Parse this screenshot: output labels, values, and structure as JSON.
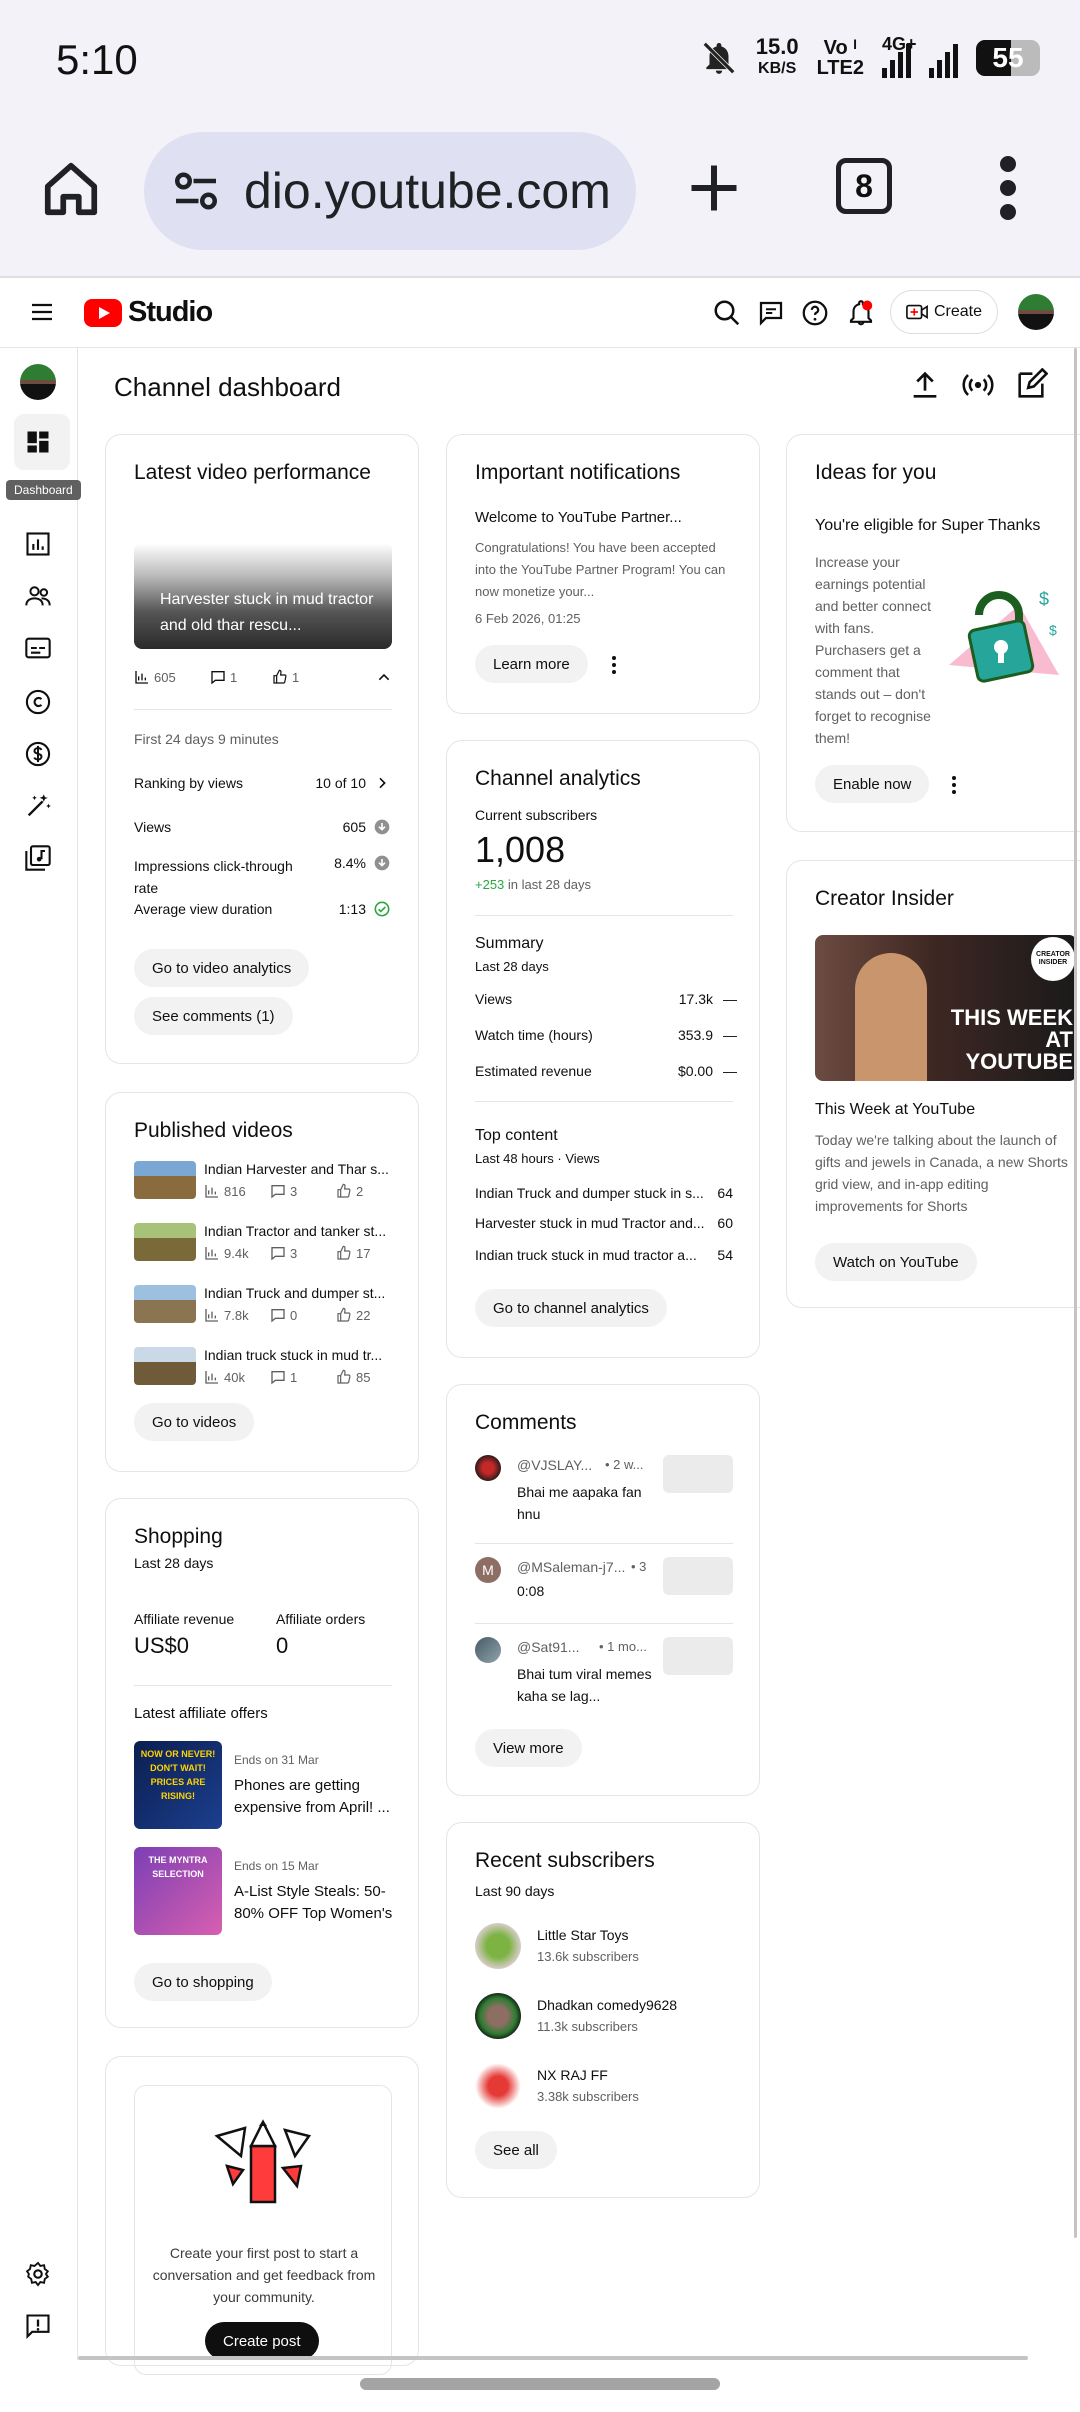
{
  "status_bar": {
    "time": "5:10",
    "speed_value": "15.0",
    "speed_unit": "KB/S",
    "volte_top": "Vo ᴵ",
    "volte_bottom": "LTE2",
    "net": "4G+",
    "battery": "55"
  },
  "browser": {
    "url": "dio.youtube.com",
    "tab_count": "8"
  },
  "header": {
    "logo_text": "Studio",
    "create_label": "Create"
  },
  "rail": {
    "tooltip": "Dashboard"
  },
  "page": {
    "title": "Channel dashboard"
  },
  "latest_video": {
    "title": "Latest video performance",
    "video_title": "Harvester stuck in mud tractor and old thar rescu...",
    "views": "605",
    "comments": "1",
    "likes": "1",
    "period": "First 24 days 9 minutes",
    "rows": [
      {
        "label": "Ranking by views",
        "value": "10 of 10"
      },
      {
        "label": "Views",
        "value": "605"
      },
      {
        "label": "Impressions click-through rate",
        "value": "8.4%"
      },
      {
        "label": "Average view duration",
        "value": "1:13"
      }
    ],
    "btn_analytics": "Go to video analytics",
    "btn_comments": "See comments (1)"
  },
  "published": {
    "title": "Published videos",
    "items": [
      {
        "title": "Indian Harvester and Thar s...",
        "views": "816",
        "comments": "3",
        "likes": "2"
      },
      {
        "title": "Indian Tractor and tanker st...",
        "views": "9.4k",
        "comments": "3",
        "likes": "17"
      },
      {
        "title": "Indian Truck and dumper st...",
        "views": "7.8k",
        "comments": "0",
        "likes": "22"
      },
      {
        "title": "Indian truck stuck in mud tr...",
        "views": "40k",
        "comments": "1",
        "likes": "85"
      }
    ],
    "btn": "Go to videos"
  },
  "shopping": {
    "title": "Shopping",
    "period": "Last 28 days",
    "rev_label": "Affiliate revenue",
    "rev_value": "US$0",
    "orders_label": "Affiliate orders",
    "orders_value": "0",
    "offers_title": "Latest affiliate offers",
    "offers": [
      {
        "ends": "Ends on 31 Mar",
        "title": "Phones are getting expensive from April! ...",
        "img_text": "NOW OR NEVER! DON'T WAIT! PRICES ARE RISING!"
      },
      {
        "ends": "Ends on 15 Mar",
        "title": "A-List Style Steals: 50-80% OFF Top Women's ...",
        "img_text": "THE MYNTRA SELECTION"
      }
    ],
    "btn": "Go to shopping"
  },
  "post": {
    "text": "Create your first post to start a conversation and get feedback from your community.",
    "btn": "Create post"
  },
  "notifications": {
    "title": "Important notifications",
    "heading": "Welcome to YouTube Partner...",
    "body": "Congratulations! You have been accepted into the YouTube Partner Program! You can now monetize your...",
    "date": "6 Feb 2026, 01:25",
    "btn": "Learn more"
  },
  "analytics": {
    "title": "Channel analytics",
    "subs_label": "Current subscribers",
    "subs_value": "1,008",
    "subs_delta": "+253",
    "subs_delta_suffix": "in last 28 days",
    "summary_title": "Summary",
    "summary_period": "Last 28 days",
    "summary": [
      {
        "label": "Views",
        "value": "17.3k",
        "trend": "—"
      },
      {
        "label": "Watch time (hours)",
        "value": "353.9",
        "trend": "—"
      },
      {
        "label": "Estimated revenue",
        "value": "$0.00",
        "trend": "—"
      }
    ],
    "top_title": "Top content",
    "top_period": "Last 48 hours · Views",
    "top": [
      {
        "title": "Indian Truck and dumper stuck in s...",
        "value": "64"
      },
      {
        "title": "Harvester stuck in mud Tractor and...",
        "value": "60"
      },
      {
        "title": "Indian truck stuck in mud tractor a...",
        "value": "54"
      }
    ],
    "btn": "Go to channel analytics"
  },
  "comments": {
    "title": "Comments",
    "items": [
      {
        "author": "@VJSLAY...",
        "time": "• 2 w...",
        "text": "Bhai me aapaka fan hnu",
        "initial": ""
      },
      {
        "author": "@MSaleman-j7...",
        "time": "• 3",
        "text": "0:08",
        "initial": "M"
      },
      {
        "author": "@Sat91...",
        "time": "• 1 mo...",
        "text": "Bhai tum viral memes kaha se lag...",
        "initial": ""
      }
    ],
    "btn": "View more"
  },
  "recent_subs": {
    "title": "Recent subscribers",
    "period": "Last 90 days",
    "items": [
      {
        "name": "Little Star Toys",
        "count": "13.6k subscribers"
      },
      {
        "name": "Dhadkan comedy9628",
        "count": "11.3k subscribers"
      },
      {
        "name": "NX RAJ FF",
        "count": "3.38k subscribers"
      }
    ],
    "btn": "See all"
  },
  "ideas": {
    "title": "Ideas for you",
    "heading": "You're eligible for Super Thanks",
    "body": "Increase your earnings potential and better connect with fans. Purchasers get a comment that stands out – don't forget to recognise them!",
    "btn": "Enable now"
  },
  "insider": {
    "title": "Creator Insider",
    "thumb_text": "THIS WEEK AT YOUTUBE",
    "badge": "CREATOR INSIDER",
    "heading": "This Week at YouTube",
    "body": "Today we're talking about the launch of gifts and jewels in Canada, a new Shorts grid view, and in-app editing improvements for Shorts",
    "btn": "Watch on YouTube"
  },
  "colors": {
    "accent_red": "#ff0000",
    "positive_green": "#2ba640",
    "text": "#0f0f0f",
    "muted": "#606060"
  }
}
